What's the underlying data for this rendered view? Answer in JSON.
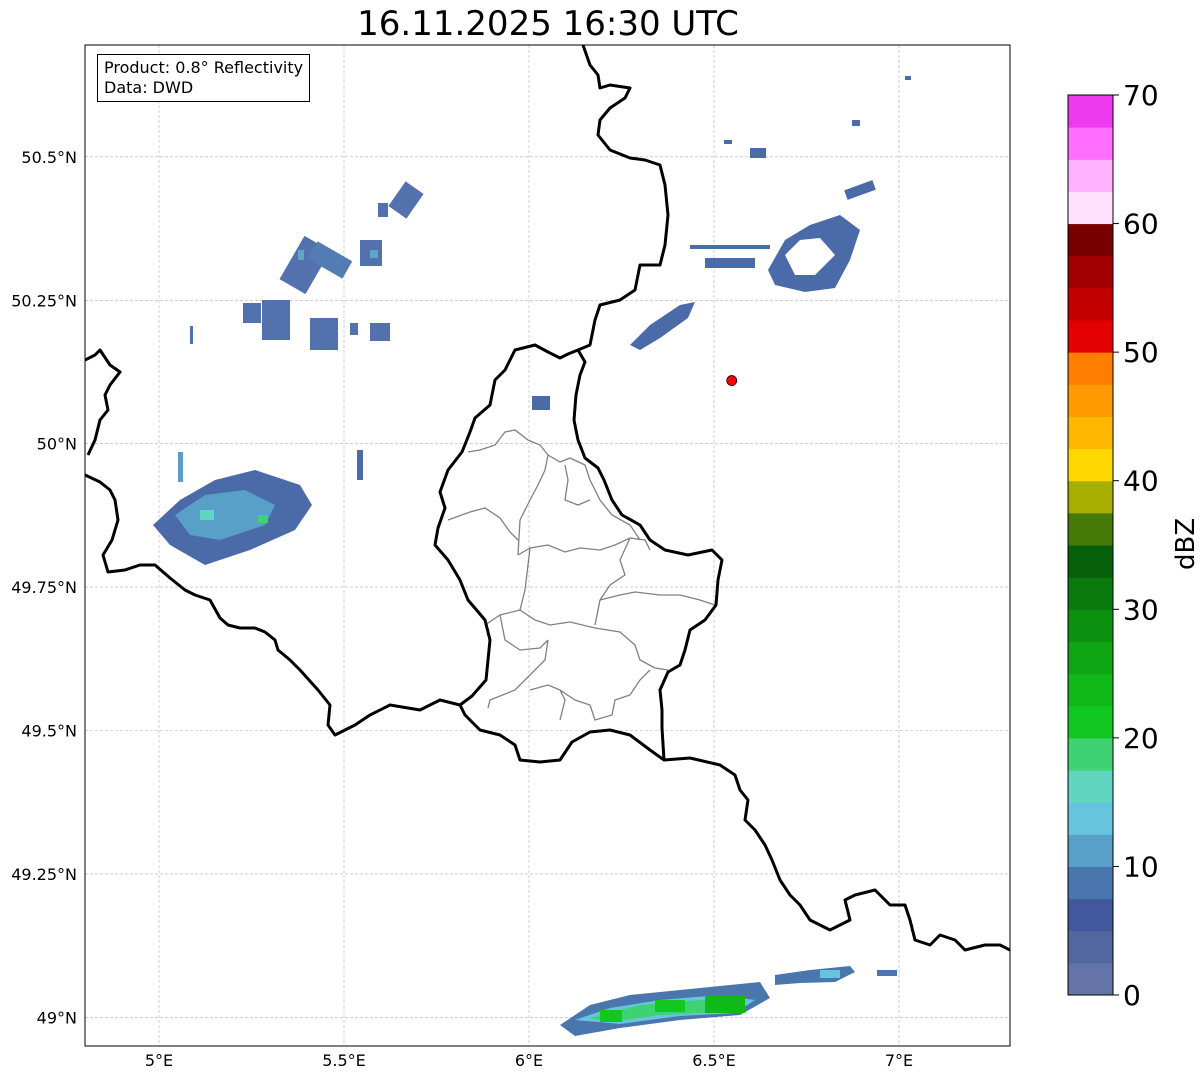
{
  "title": "16.11.2025 16:30 UTC",
  "info": {
    "product": "Product: 0.8° Reflectivity",
    "data": "Data: DWD"
  },
  "map": {
    "lon_range": [
      4.8,
      7.3
    ],
    "lat_range": [
      48.95,
      50.695
    ],
    "x_ticks": [
      {
        "v": 5.0,
        "label": "5°E"
      },
      {
        "v": 5.5,
        "label": "5.5°E"
      },
      {
        "v": 6.0,
        "label": "6°E"
      },
      {
        "v": 6.5,
        "label": "6.5°E"
      },
      {
        "v": 7.0,
        "label": "7°E"
      }
    ],
    "y_ticks": [
      {
        "v": 49.0,
        "label": "49°N"
      },
      {
        "v": 49.25,
        "label": "49.25°N"
      },
      {
        "v": 49.5,
        "label": "49.5°N"
      },
      {
        "v": 49.75,
        "label": "49.75°N"
      },
      {
        "v": 50.0,
        "label": "50°N"
      },
      {
        "v": 50.25,
        "label": "50.25°N"
      },
      {
        "v": 50.5,
        "label": "50.5°N"
      }
    ],
    "grid": true,
    "radar_site": {
      "lon": 6.548,
      "lat": 50.11,
      "color": "#ff0000"
    }
  },
  "colorbar": {
    "label": "dBZ",
    "min": 0,
    "max": 70,
    "ticks": [
      0,
      10,
      20,
      30,
      40,
      50,
      60,
      70
    ],
    "colors": [
      "#6474a8",
      "#5266a0",
      "#42589e",
      "#4a76ae",
      "#58a0c8",
      "#66c4dc",
      "#60d6c0",
      "#3ed272",
      "#12c820",
      "#10b818",
      "#0ea414",
      "#0c9010",
      "#0a7a0e",
      "#06600a",
      "#457a08",
      "#a8ae00",
      "#ffd800",
      "#ffb700",
      "#ff9a00",
      "#ff7e00",
      "#e20000",
      "#c20000",
      "#a00000",
      "#780000",
      "#ffe1ff",
      "#ffb2ff",
      "#ff6eff",
      "#ee3aee"
    ]
  }
}
